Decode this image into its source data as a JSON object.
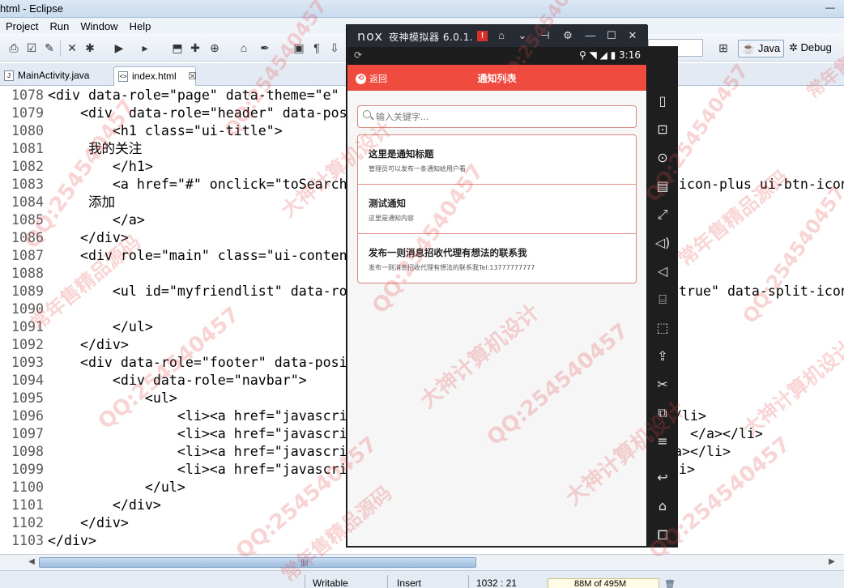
{
  "window": {
    "title": "html - Eclipse",
    "minimize": "—",
    "close": "✕"
  },
  "menubar": [
    "Project",
    "Run",
    "Window",
    "Help"
  ],
  "perspectives": {
    "java": "Java",
    "debug": "Debug"
  },
  "tabs": [
    {
      "label": "MainActivity.java",
      "icon": "java-file-icon"
    },
    {
      "label": "index.html",
      "icon": "html-file-icon",
      "close": "☒"
    }
  ],
  "editor": {
    "lines": [
      {
        "num": "1078",
        "text": "<div data-role=\"page\" data-theme=\"e\""
      },
      {
        "num": "1079",
        "text": "    <div  data-role=\"header\" data-pos"
      },
      {
        "num": "1080",
        "text": "        <h1 class=\"ui-title\">"
      },
      {
        "num": "1081",
        "text": "     我的关注"
      },
      {
        "num": "1082",
        "text": "        </h1>"
      },
      {
        "num": "1083",
        "text": "        <a href=\"#\" onclick=\"toSearch"
      },
      {
        "num": "1084",
        "text": "     添加"
      },
      {
        "num": "1085",
        "text": "        </a>"
      },
      {
        "num": "1086",
        "text": "    </div>"
      },
      {
        "num": "1087",
        "text": "    <div role=\"main\" class=\"ui-conten"
      },
      {
        "num": "1088",
        "text": ""
      },
      {
        "num": "1089",
        "text": "        <ul id=\"myfriendlist\" data-ro"
      },
      {
        "num": "1090",
        "text": ""
      },
      {
        "num": "1091",
        "text": "        </ul>"
      },
      {
        "num": "1092",
        "text": "    </div>"
      },
      {
        "num": "1093",
        "text": "    <div data-role=\"footer\" data-posi"
      },
      {
        "num": "1094",
        "text": "        <div data-role=\"navbar\">"
      },
      {
        "num": "1095",
        "text": "            <ul>"
      },
      {
        "num": "1096",
        "text": "                <li><a href=\"javascri"
      },
      {
        "num": "1097",
        "text": "                <li><a href=\"javascri"
      },
      {
        "num": "1098",
        "text": "                <li><a href=\"javascri"
      },
      {
        "num": "1099",
        "text": "                <li><a href=\"javascri"
      },
      {
        "num": "1100",
        "text": "            </ul>"
      },
      {
        "num": "1101",
        "text": "        </div>"
      },
      {
        "num": "1102",
        "text": "    </div>"
      },
      {
        "num": "1103",
        "text": "</div>"
      }
    ],
    "right_fragments": [
      {
        "row": 5,
        "text": "icon-plus ui-btn-icon"
      },
      {
        "row": 11,
        "text": "true\" data-split-icon"
      },
      {
        "row": 18,
        "text": "/li>"
      },
      {
        "row": 19,
        "text": "</a></li>"
      },
      {
        "row": 20,
        "text": "a></li>"
      },
      {
        "row": 21,
        "text": "i>"
      }
    ]
  },
  "status": {
    "writable": "Writable",
    "insert": "Insert",
    "position": "1032 : 21",
    "heap": "88M of 495M"
  },
  "emulator": {
    "brand": "nox",
    "name": "夜神模拟器 6.0.1.",
    "warning": "!",
    "time": "3:16",
    "app": {
      "back_label": "返回",
      "title": "通知列表",
      "search_placeholder": "输入关键字...",
      "notices": [
        {
          "title": "这里是通知标题",
          "desc": "管理员可以发布一条通知给用户看"
        },
        {
          "title": "测试通知",
          "desc": "这里是通知内容"
        },
        {
          "title": "发布一则消息招收代理有想法的联系我",
          "desc": "发布一则消息招收代理有想法的联系我Tel:13777777777"
        }
      ]
    }
  },
  "watermarks": [
    "QQ:254540457",
    "大神计算机设计",
    "常年售精品源码"
  ]
}
